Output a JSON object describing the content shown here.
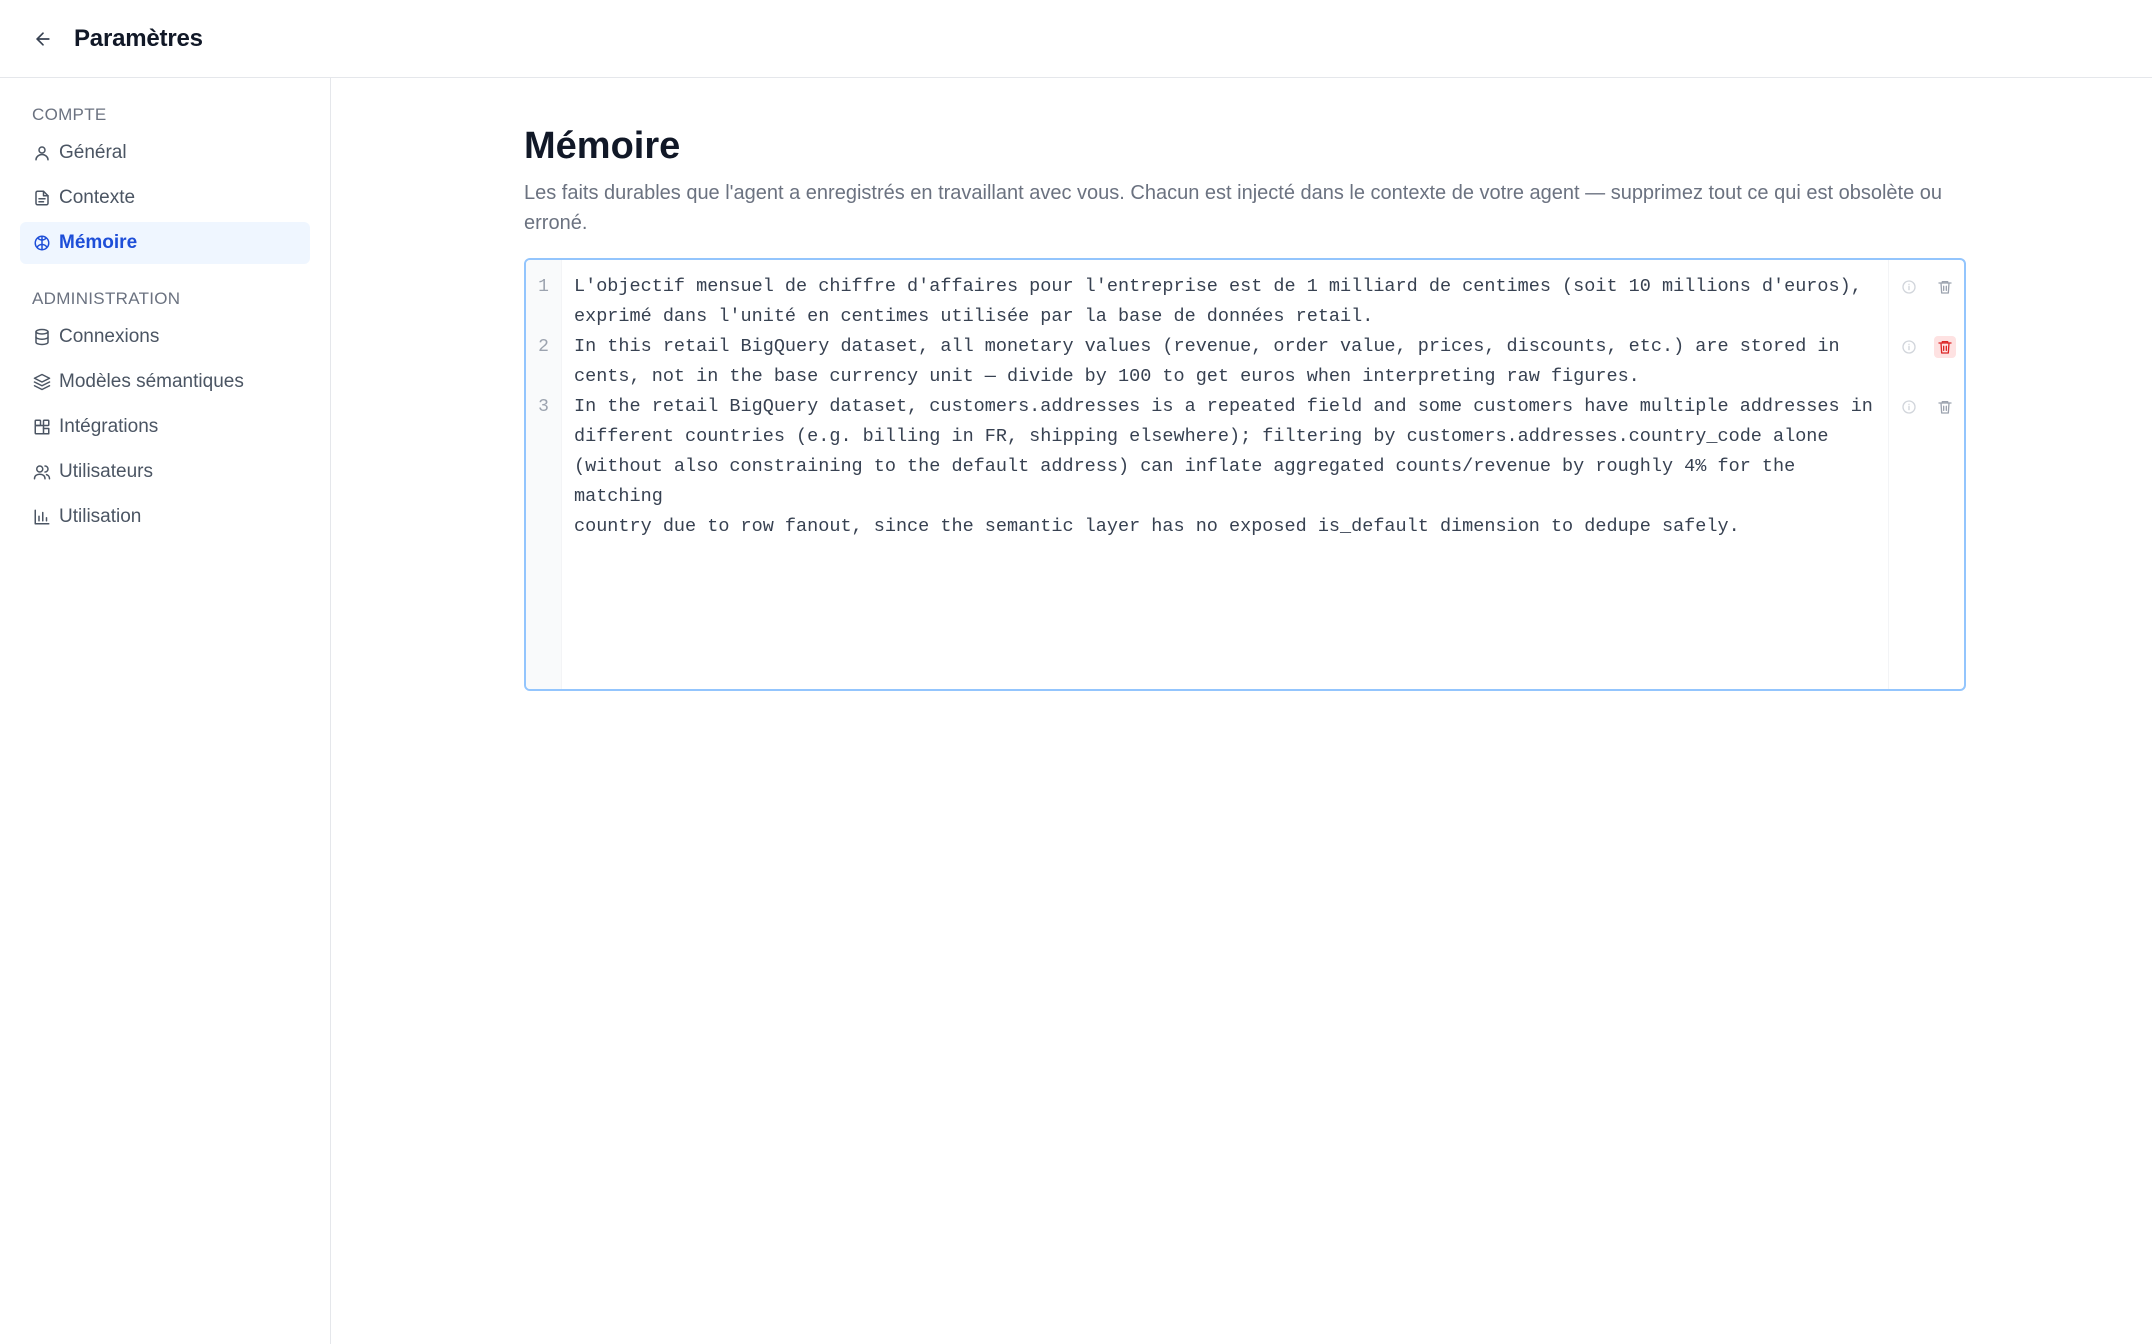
{
  "header": {
    "title": "Paramètres"
  },
  "sidebar": {
    "sections": [
      {
        "label": "COMPTE",
        "items": [
          {
            "label": "Général",
            "icon": "user-icon"
          },
          {
            "label": "Contexte",
            "icon": "document-icon"
          },
          {
            "label": "Mémoire",
            "icon": "brain-icon",
            "active": true
          }
        ]
      },
      {
        "label": "ADMINISTRATION",
        "items": [
          {
            "label": "Connexions",
            "icon": "database-icon"
          },
          {
            "label": "Modèles sémantiques",
            "icon": "layers-icon"
          },
          {
            "label": "Intégrations",
            "icon": "puzzle-icon"
          },
          {
            "label": "Utilisateurs",
            "icon": "users-icon"
          },
          {
            "label": "Utilisation",
            "icon": "bar-chart-icon"
          }
        ]
      }
    ]
  },
  "main": {
    "title": "Mémoire",
    "description": "Les faits durables que l'agent a enregistrés en travaillant avec vous. Chacun est injecté dans le contexte de votre agent — supprimez tout ce qui est obsolète ou erroné.",
    "memories": [
      {
        "number": "1",
        "text": "L'objectif mensuel de chiffre d'affaires pour l'entreprise est de 1 milliard de centimes (soit 10 millions d'euros),\nexprimé dans l'unité en centimes utilisée par la base de données retail."
      },
      {
        "number": "2",
        "text": "In this retail BigQuery dataset, all monetary values (revenue, order value, prices, discounts, etc.) are stored in\ncents, not in the base currency unit — divide by 100 to get euros when interpreting raw figures.",
        "delete_highlighted": true
      },
      {
        "number": "3",
        "text": "In the retail BigQuery dataset, customers.addresses is a repeated field and some customers have multiple addresses in\ndifferent countries (e.g. billing in FR, shipping elsewhere); filtering by customers.addresses.country_code alone\n(without also constraining to the default address) can inflate aggregated counts/revenue by roughly 4% for the matching\ncountry due to row fanout, since the semantic layer has no exposed is_default dimension to dedupe safely."
      }
    ]
  },
  "colors": {
    "accent": "#1d4ed8",
    "active_bg": "#eff6ff",
    "editor_border": "#93c5fd",
    "danger": "#dc2626",
    "danger_bg": "#fee2e2"
  }
}
